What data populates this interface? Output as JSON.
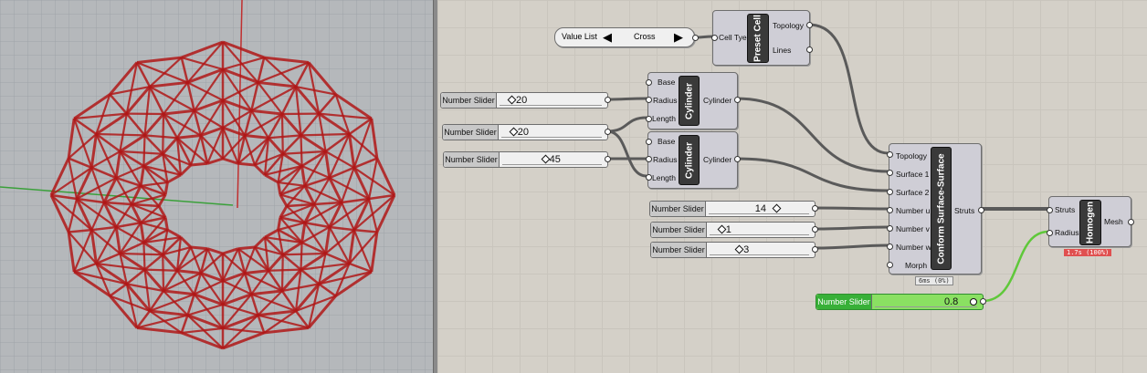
{
  "canvas": {
    "value_list": {
      "label": "Value List",
      "selected": "Cross"
    },
    "preset_cell": {
      "name": "Preset Cell",
      "inputs": [
        "Cell Tye"
      ],
      "outputs": [
        "Topology",
        "Lines"
      ]
    },
    "cylinder1": {
      "name": "Cylinder",
      "inputs": [
        "Base",
        "Radius",
        "Length"
      ],
      "output": "Cylinder"
    },
    "cylinder2": {
      "name": "Cylinder",
      "inputs": [
        "Base",
        "Radius",
        "Length"
      ],
      "output": "Cylinder"
    },
    "conform": {
      "name": "Conform Surface-Surface",
      "inputs": [
        "Topology",
        "Surface 1",
        "Surface 2",
        "Number u",
        "Number v",
        "Number w",
        "Morph"
      ],
      "output": "Struts",
      "timing": "6ms (0%)"
    },
    "homogen": {
      "name": "Homogen",
      "inputs": [
        "Struts",
        "Radius"
      ],
      "output": "Mesh",
      "timing": "1.7s (100%)"
    },
    "sliders": [
      {
        "label": "Number Slider",
        "value": "20",
        "level": 0.1
      },
      {
        "label": "Number Slider",
        "value": "20",
        "level": 0.1
      },
      {
        "label": "Number Slider",
        "value": "45",
        "level": 0.45
      },
      {
        "label": "Number Slider",
        "value": "14",
        "level": 0.6
      },
      {
        "label": "Number Slider",
        "value": "1",
        "level": 0.1
      },
      {
        "label": "Number Slider",
        "value": "3",
        "level": 0.3
      },
      {
        "label": "Number Slider",
        "value": "0.8",
        "level": 0.8
      }
    ]
  },
  "colors": {
    "viewport_bg": "#b5b8bb",
    "lattice": "#b01818",
    "canvas_bg": "#d4d0c8",
    "active_slider": "#8ae062",
    "error_timing": "#e05050"
  },
  "icons": [
    "arrow-left-icon",
    "arrow-right-icon"
  ]
}
